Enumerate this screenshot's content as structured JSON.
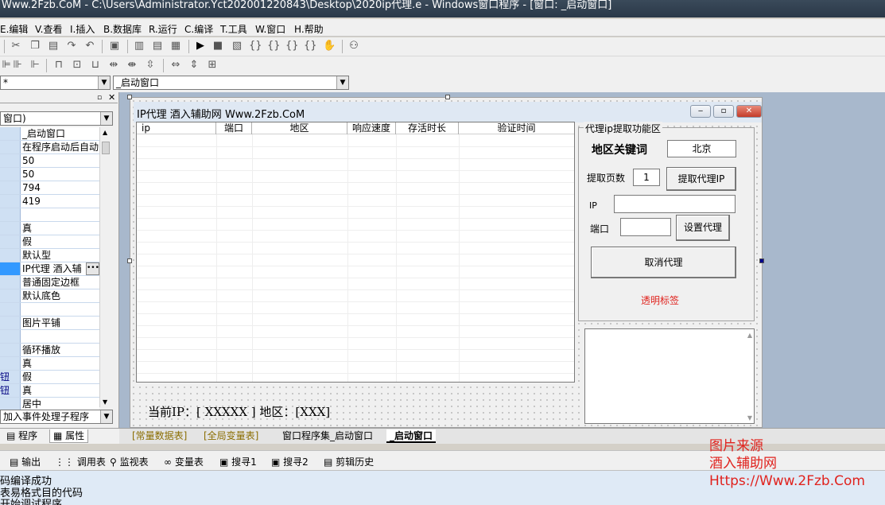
{
  "window": {
    "title": "Www.2Fzb.CoM - C:\\Users\\Administrator.Yct202001220843\\Desktop\\2020ip代理.e - Windows窗口程序 - [窗口: _启动窗口]"
  },
  "menu": {
    "items": [
      "E.编辑",
      "V.查看",
      "I.插入",
      "B.数据库",
      "R.运行",
      "C.编译",
      "T.工具",
      "W.窗口",
      "H.帮助"
    ]
  },
  "combos": {
    "left_value": "*",
    "right_value": "_启动窗口"
  },
  "property_panel": {
    "object_combo": "窗口)",
    "rows": [
      {
        "key": "",
        "value": "_启动窗口"
      },
      {
        "key": "",
        "value": "在程序启动后自动"
      },
      {
        "key": "",
        "value": "50"
      },
      {
        "key": "",
        "value": "50"
      },
      {
        "key": "",
        "value": "794"
      },
      {
        "key": "",
        "value": "419"
      },
      {
        "key": "",
        "value": ""
      },
      {
        "key": "",
        "value": "真"
      },
      {
        "key": "",
        "value": "假"
      },
      {
        "key": "",
        "value": "默认型"
      },
      {
        "key": "",
        "value": "IP代理  酒入辅"
      },
      {
        "key": "",
        "value": "普通固定边框"
      },
      {
        "key": "",
        "value": "默认底色"
      },
      {
        "key": "",
        "value": ""
      },
      {
        "key": "",
        "value": "图片平铺"
      },
      {
        "key": "",
        "value": ""
      },
      {
        "key": "",
        "value": "循环播放"
      },
      {
        "key": "",
        "value": "真"
      },
      {
        "key": "钮",
        "value": "假"
      },
      {
        "key": "钮",
        "value": "真"
      },
      {
        "key": "",
        "value": "居中"
      }
    ],
    "event_combo": "加入事件处理子程序",
    "tabs": [
      "程序",
      "属性"
    ]
  },
  "form": {
    "title": "IP代理  酒入辅助网 Www.2Fzb.CoM",
    "list_columns": [
      "ip",
      "端口",
      "地区",
      "响应速度",
      "存活时长",
      "验证时间"
    ],
    "group_title": "代理ip提取功能区",
    "region_label": "地区关键词",
    "region_value": "北京",
    "pages_label": "提取页数",
    "pages_value": "1",
    "fetch_button": "提取代理IP",
    "ip_label": "IP",
    "ip_value": "",
    "port_label": "端口",
    "port_value": "",
    "set_proxy_button": "设置代理",
    "cancel_proxy_button": "取消代理",
    "transparent_label": "透明标签",
    "status_line": "当前IP：[ XXXXX ] 地区：[XXX]"
  },
  "editor_tabs": [
    "[常量数据表]",
    "[全局变量表]",
    "窗口程序集_启动窗口",
    "_启动窗口"
  ],
  "output_tabs": [
    "输出",
    "调用表",
    "监视表",
    "变量表",
    "搜寻1",
    "搜寻2",
    "剪辑历史"
  ],
  "output_lines": [
    "码编译成功",
    "表易格式目的代码",
    "开始调试程序"
  ],
  "watermark": [
    "图片来源",
    "酒入辅助网",
    "Https://Www.2Fzb.Com"
  ],
  "colors": {
    "accent_red": "#e0231e",
    "selection_blue": "#3399ff",
    "designer_bg": "#a8b8cc"
  }
}
